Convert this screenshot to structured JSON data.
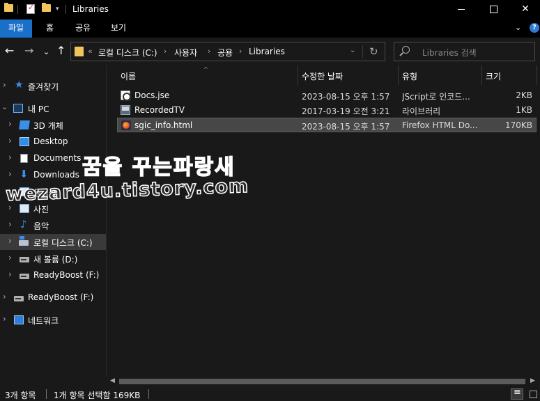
{
  "window": {
    "title": "Libraries",
    "qa_dropdown": "▾",
    "close_glyph": "✕"
  },
  "ribbon": {
    "tabs": [
      "파일",
      "홈",
      "공유",
      "보기"
    ],
    "expand_glyph": "⌄",
    "help_glyph": "?"
  },
  "nav": {
    "back": "←",
    "forward": "→",
    "recent": "⌄",
    "up": "↑",
    "overflow": "«",
    "breadcrumb": [
      "로컬 디스크 (C:)",
      "사용자",
      "공용",
      "Libraries"
    ],
    "crumb_sep": "›",
    "dropdown": "⌄",
    "refresh": "↻"
  },
  "search": {
    "placeholder": "Libraries 검색"
  },
  "sidebar": {
    "items": [
      {
        "label": "즐겨찾기",
        "icon": "star-icon"
      },
      {
        "label": "내 PC",
        "icon": "computer-icon"
      },
      {
        "label": "3D 개체",
        "icon": "3d-objects-icon"
      },
      {
        "label": "Desktop",
        "icon": "desktop-icon"
      },
      {
        "label": "Documents",
        "icon": "documents-icon"
      },
      {
        "label": "Downloads",
        "icon": "downloads-icon"
      },
      {
        "label": "동영상",
        "icon": "videos-icon"
      },
      {
        "label": "사진",
        "icon": "pictures-icon"
      },
      {
        "label": "음악",
        "icon": "music-icon"
      },
      {
        "label": "로컬 디스크 (C:)",
        "icon": "local-disk-icon"
      },
      {
        "label": "새 볼륨 (D:)",
        "icon": "drive-icon"
      },
      {
        "label": "ReadyBoost (F:)",
        "icon": "drive-icon"
      },
      {
        "label": "ReadyBoost (F:)",
        "icon": "drive-icon"
      },
      {
        "label": "네트워크",
        "icon": "network-icon"
      }
    ],
    "expander": "›",
    "expander_open": "⌄"
  },
  "columns": {
    "name": "이름",
    "modified": "수정한 날짜",
    "type": "유형",
    "size": "크기",
    "sort_glyph": "^"
  },
  "files": [
    {
      "name": "Docs.jse",
      "modified": "2023-08-15 오후 1:57",
      "type": "JScript로 인코드...",
      "size": "2KB",
      "icon": "jse-file-icon"
    },
    {
      "name": "RecordedTV",
      "modified": "2017-03-19 오전 3:21",
      "type": "라이브러리",
      "size": "1KB",
      "icon": "library-icon"
    },
    {
      "name": "sgic_info.html",
      "modified": "2023-08-15 오후 1:57",
      "type": "Firefox HTML Do...",
      "size": "170KB",
      "icon": "firefox-html-icon"
    }
  ],
  "scrollbar": {
    "left": "◀",
    "right": "▶"
  },
  "status": {
    "item_count": "3개 항목",
    "selection": "1개 항목 선택함 169KB"
  },
  "watermark": {
    "line1": "꿈을 꾸는파랑새",
    "line2": "wezard4u.tistory.com"
  }
}
